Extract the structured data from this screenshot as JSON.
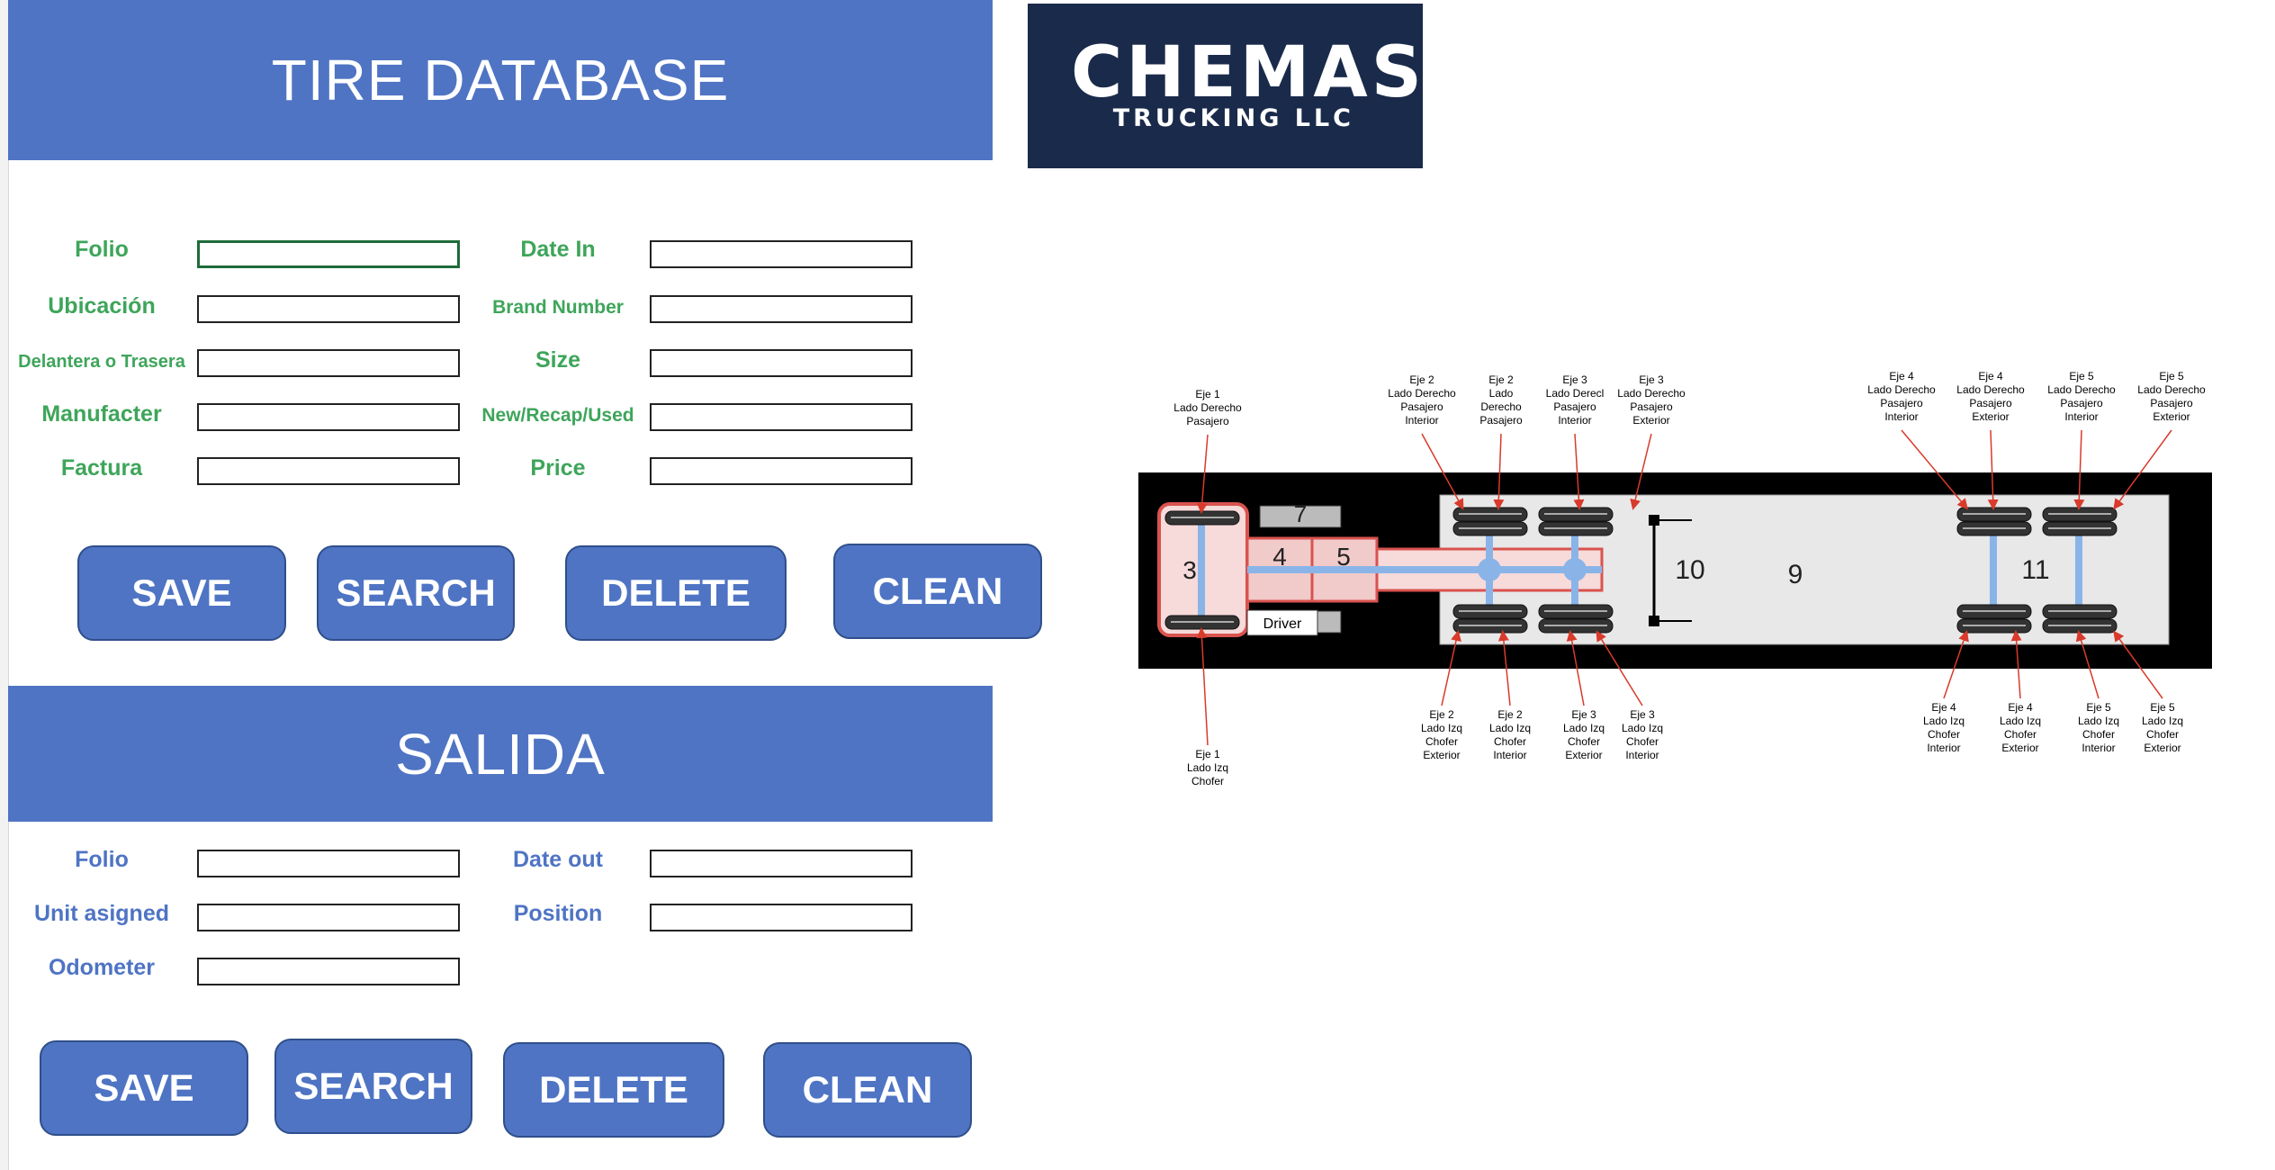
{
  "entrada": {
    "title": "TIRE DATABASE",
    "fields": [
      {
        "label": "Folio",
        "value": ""
      },
      {
        "label": "Date In",
        "value": ""
      },
      {
        "label": "Ubicación",
        "value": ""
      },
      {
        "label": "Brand Number",
        "value": ""
      },
      {
        "label": "Delantera o Trasera",
        "value": ""
      },
      {
        "label": "Size",
        "value": ""
      },
      {
        "label": "Manufacter",
        "value": ""
      },
      {
        "label": "New/Recap/Used",
        "value": ""
      },
      {
        "label": "Factura",
        "value": ""
      },
      {
        "label": "Price",
        "value": ""
      }
    ],
    "buttons": {
      "save": "SAVE",
      "search": "SEARCH",
      "delete": "DELETE",
      "clean": "CLEAN"
    }
  },
  "salida": {
    "title": "SALIDA",
    "fields": [
      {
        "label": "Folio",
        "value": ""
      },
      {
        "label": "Date out",
        "value": ""
      },
      {
        "label": "Unit asigned",
        "value": ""
      },
      {
        "label": "Position",
        "value": ""
      },
      {
        "label": "Odometer",
        "value": ""
      }
    ],
    "buttons": {
      "save": "SAVE",
      "search": "SEARCH",
      "delete": "DELETE",
      "clean": "CLEAN"
    }
  },
  "logo": {
    "name": "CHEMAS",
    "subtitle": "TRUCKING LLC"
  },
  "diagram": {
    "sections": [
      "3",
      "4",
      "5",
      "7",
      "10",
      "9",
      "11"
    ],
    "driver_label": "Driver",
    "top_labels": [
      [
        "Eje 1",
        "Lado Derecho",
        "Pasajero"
      ],
      [
        "Eje 2",
        "Lado Derecho",
        "Pasajero",
        "Interior"
      ],
      [
        "Eje 2",
        "Lado",
        "Derecho",
        "Pasajero"
      ],
      [
        "Eje 3",
        "Lado Derecl",
        "Pasajero",
        "Interior"
      ],
      [
        "Eje 3",
        "Lado Derecho",
        "Pasajero",
        "Exterior"
      ],
      [
        "Eje 4",
        "Lado Derecho",
        "Pasajero",
        "Interior"
      ],
      [
        "Eje 4",
        "Lado Derecho",
        "Pasajero",
        "Exterior"
      ],
      [
        "Eje 5",
        "Lado Derecho",
        "Pasajero",
        "Interior"
      ],
      [
        "Eje 5",
        "Lado Derecho",
        "Pasajero",
        "Exterior"
      ]
    ],
    "bottom_labels": [
      [
        "Eje 1",
        "Lado Izq",
        "Chofer"
      ],
      [
        "Eje 2",
        "Lado Izq",
        "Chofer",
        "Exterior"
      ],
      [
        "Eje 2",
        "Lado Izq",
        "Chofer",
        "Interior"
      ],
      [
        "Eje 3",
        "Lado Izq",
        "Chofer",
        "Exterior"
      ],
      [
        "Eje 3",
        "Lado Izq",
        "Chofer",
        "Interior"
      ],
      [
        "Eje 4",
        "Lado Izq",
        "Chofer",
        "Interior"
      ],
      [
        "Eje 4",
        "Lado Izq",
        "Chofer",
        "Exterior"
      ],
      [
        "Eje 5",
        "Lado Izq",
        "Chofer",
        "Interior"
      ],
      [
        "Eje 5",
        "Lado Izq",
        "Chofer",
        "Exterior"
      ]
    ],
    "colors": {
      "frame": "#000000",
      "axle": "#8ab4e8",
      "cab_outline": "#d9534f",
      "arrow": "#d93a2b",
      "trailer": "#e8e8e8"
    }
  },
  "colors": {
    "banner": "#4f74c4",
    "label_green": "#3ea55a",
    "label_blue": "#4f74c4",
    "button": "#4f74c4",
    "logo_bg": "#1a2a4a"
  }
}
